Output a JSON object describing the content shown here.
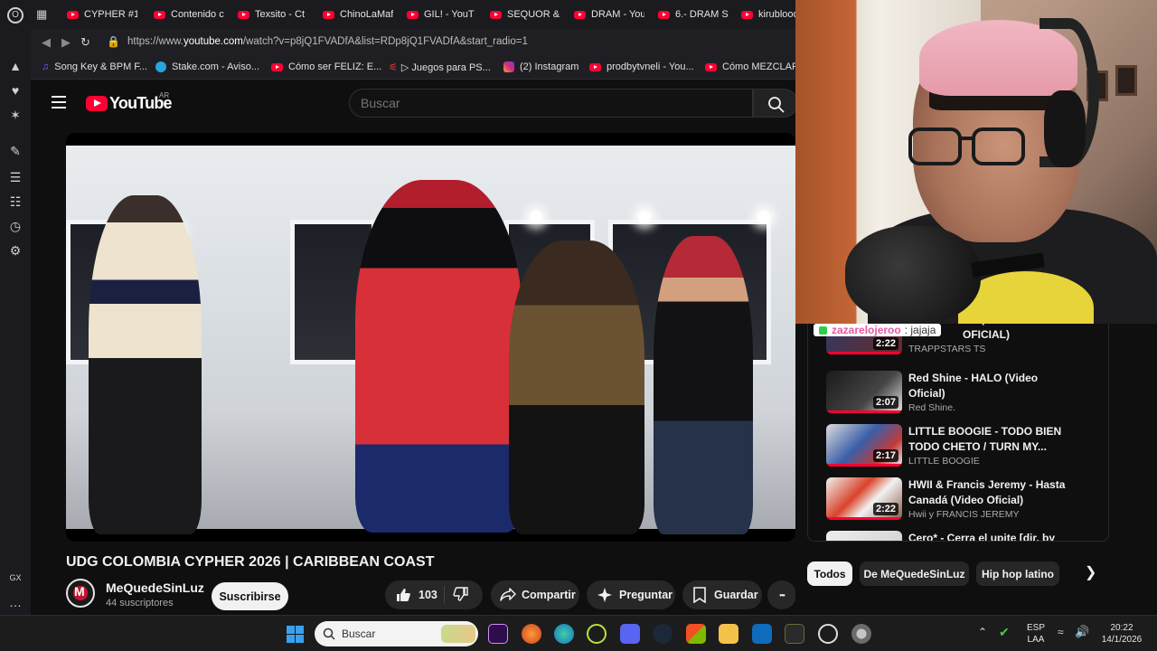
{
  "browser": {
    "tabs": [
      "CYPHER #1¹",
      "Contenido c",
      "Texsito - Ct",
      "ChinoLaMaf",
      "GIL! - YouT",
      "SEQUOR & ",
      "DRAM - You",
      "6.- DRAM S",
      "kirublood"
    ],
    "url_prefix": "https://www.",
    "url_domain": "youtube.com",
    "url_path": "/watch?v=p8jQ1FVADfA&list=RDp8jQ1FVADfA&start_radio=1",
    "bookmarks": [
      "Song Key & BPM F...",
      "Stake.com - Aviso...",
      "Cómo ser FELIZ: E...",
      "Juegos para PS...",
      "(2) Instagram",
      "prodbytvneli - You...",
      "Cómo MEZCLAR"
    ],
    "left_rail_label": "GX",
    "left_rail_more": "…"
  },
  "youtube": {
    "logo_text": "YouTube",
    "country": "AR",
    "search_placeholder": "Buscar",
    "video_title": "UDG COLOMBIA CYPHER 2026 | CARIBBEAN COAST",
    "channel_name": "MeQuedeSinLuz",
    "channel_avatar_text": "M",
    "channel_subs": "44 suscriptores",
    "subscribe_label": "Suscribirse",
    "likes": "103",
    "share_label": "Compartir",
    "ask_label": "Preguntar",
    "save_label": "Guardar",
    "more_label": "•••"
  },
  "chat": {
    "user": "zazarelojeroo",
    "message": ": jajaja"
  },
  "recommendations": [
    {
      "title": "1/1 (VIDEO OFICIAL)",
      "channel": "TRAPPSTARS TS",
      "duration": "2:22"
    },
    {
      "title": "Red Shine - HALO (Video Oficial)",
      "channel": "Red Shine.",
      "duration": "2:07"
    },
    {
      "title": "LITTLE BOOGIE - TODO BIEN TODO CHETO / TURN MY...",
      "channel": "LITTLE BOOGIE",
      "duration": "2:17"
    },
    {
      "title": "HWII & Francis Jeremy - Hasta Canadá (Video Oficial)",
      "channel": "Hwii y FRANCIS JEREMY",
      "duration": "2:22"
    },
    {
      "title": "Cero* - Cerra el upite [dir. by",
      "channel": "",
      "duration": ""
    }
  ],
  "chips": [
    "Todos",
    "De MeQuedeSinLuz",
    "Hip hop latino"
  ],
  "taskbar": {
    "search_label": "Buscar",
    "lang_top": "ESP",
    "lang_bottom": "LAA",
    "time": "20:22",
    "date": "14/1/2026"
  },
  "colors": {
    "accent_red": "#ff0033",
    "page_bg": "#0f0f0f"
  }
}
